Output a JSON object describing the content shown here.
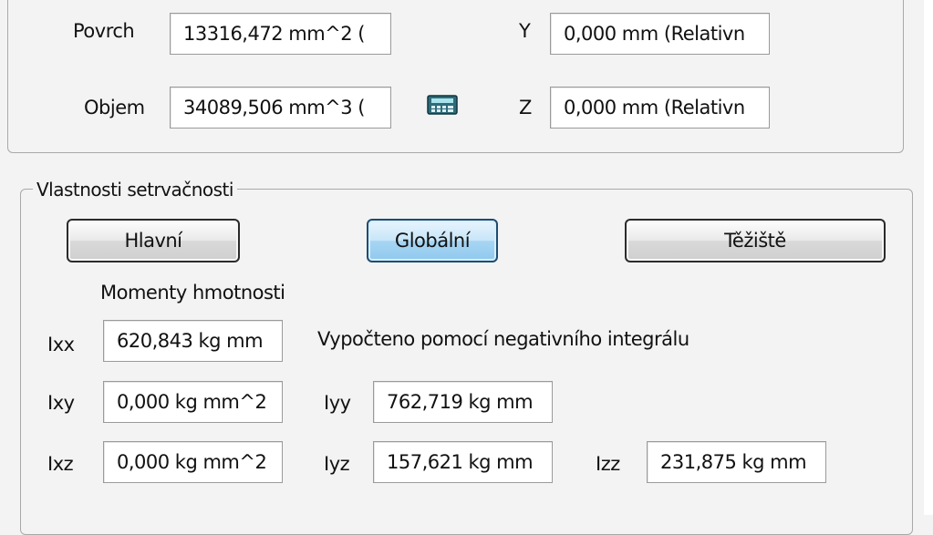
{
  "geometry": {
    "surface_label": "Povrch",
    "surface_value": "13316,472 mm^2 (",
    "volume_label": "Objem",
    "volume_value": "34089,506 mm^3 (",
    "y_label": "Y",
    "y_value": "0,000 mm (Relativn",
    "z_label": "Z",
    "z_value": "0,000 mm (Relativn",
    "calculator_icon": "calculator-icon"
  },
  "inertia": {
    "group_title": "Vlastnosti setrvačnosti",
    "buttons": {
      "principal": "Hlavní",
      "global": "Globální",
      "centroid": "Těžiště"
    },
    "active_button": "global",
    "moments_title": "Momenty hmotnosti",
    "note": "Vypočteno pomocí negativního integrálu",
    "ixx_label": "Ixx",
    "ixx_value": "620,843 kg mm",
    "ixy_label": "Ixy",
    "ixy_value": "0,000 kg mm^2",
    "ixz_label": "Ixz",
    "ixz_value": "0,000 kg mm^2",
    "iyy_label": "Iyy",
    "iyy_value": "762,719 kg mm",
    "iyz_label": "Iyz",
    "iyz_value": "157,621 kg mm",
    "izz_label": "Izz",
    "izz_value": "231,875 kg mm"
  },
  "colors": {
    "active_button": "#a8d6f3",
    "calculator_icon": "#2f6b7a"
  }
}
